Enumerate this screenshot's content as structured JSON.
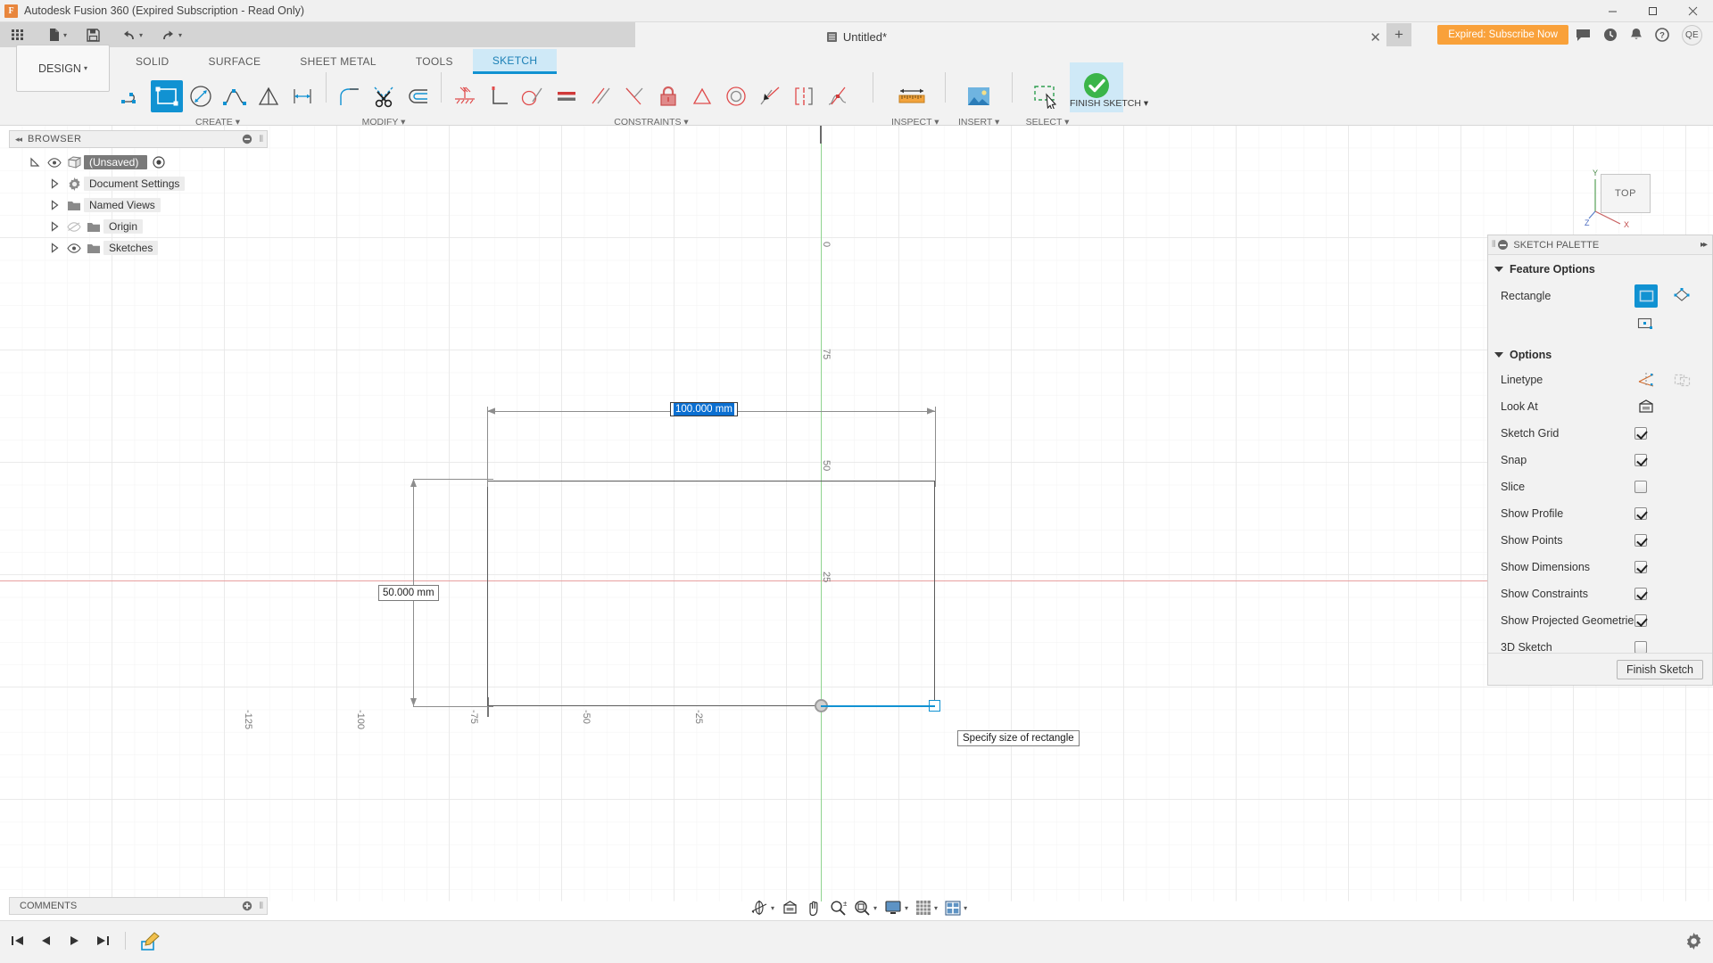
{
  "window": {
    "title": "Autodesk Fusion 360 (Expired Subscription - Read Only)",
    "logo_letter": "F",
    "minimize": "–",
    "maximize": "□",
    "close": "✕"
  },
  "quick_access": {
    "grid_icon": "app-grid-icon",
    "new_label": "new-file-icon",
    "save_label": "save-icon",
    "undo_label": "undo-icon",
    "redo_label": "redo-icon",
    "caret": "▾"
  },
  "header": {
    "document_name": "Untitled*",
    "tab_close": "✕",
    "tab_new": "+",
    "subscribe_label": "Expired: Subscribe Now",
    "avatar_initials": "QE",
    "icons": [
      "comments-icon",
      "recent-icon",
      "notifications-icon",
      "help-icon"
    ]
  },
  "ribbon": {
    "workspace_label": "DESIGN",
    "workspace_caret": "▾",
    "tabs": [
      {
        "label": "SOLID",
        "active": false
      },
      {
        "label": "SURFACE",
        "active": false
      },
      {
        "label": "SHEET METAL",
        "active": false
      },
      {
        "label": "TOOLS",
        "active": false
      },
      {
        "label": "SKETCH",
        "active": true
      }
    ],
    "groups": [
      {
        "label": "CREATE ▾",
        "name": "create-group"
      },
      {
        "label": "MODIFY ▾",
        "name": "modify-group"
      },
      {
        "label": "CONSTRAINTS ▾",
        "name": "constraints-group"
      },
      {
        "label": "INSPECT ▾",
        "name": "inspect-group"
      },
      {
        "label": "INSERT ▾",
        "name": "insert-group"
      },
      {
        "label": "SELECT ▾",
        "name": "select-group"
      },
      {
        "label": "FINISH SKETCH ▾",
        "name": "finish-sketch-group"
      }
    ],
    "tools": {
      "line": "line-icon",
      "rectangle": "rectangle-icon",
      "circle": "circle-icon",
      "spline": "spline-icon",
      "polygon": "polygon-icon",
      "sketch_dimension": "sketch-dimension-icon",
      "fillet": "fillet-icon",
      "trim": "trim-scissors-icon",
      "offset": "offset-icon",
      "constraint_fix": "fix-constraint-icon",
      "perpendicular": "perpendicular-icon",
      "tangent": "tangent-icon",
      "equal": "equal-icon",
      "parallel": "parallel-icon",
      "midpoint": "midpoint-icon",
      "lock": "lock-icon",
      "symmetry": "symmetry-icon",
      "concentric": "concentric-icon",
      "collinear": "collinear-icon",
      "curvature": "curvature-icon",
      "smooth": "smooth-icon",
      "measure": "measure-ruler-icon",
      "insert_image": "insert-image-icon",
      "select_window": "select-window-icon",
      "finish_sketch": "finish-sketch-check-icon"
    }
  },
  "browser": {
    "panel_title": "BROWSER",
    "collapse_icon": "◂◂",
    "minimize_icon": "⊖",
    "items": [
      {
        "label": "(Unsaved)",
        "icon": "component-cube-icon",
        "selected": true,
        "visible": true,
        "indent": 0,
        "has_radio": true
      },
      {
        "label": "Document Settings",
        "icon": "gear-icon",
        "selected": false,
        "visible": null,
        "indent": 1,
        "has_radio": false
      },
      {
        "label": "Named Views",
        "icon": "folder-icon",
        "selected": false,
        "visible": null,
        "indent": 1,
        "has_radio": false
      },
      {
        "label": "Origin",
        "icon": "folder-icon",
        "selected": false,
        "visible": false,
        "indent": 1,
        "has_radio": false
      },
      {
        "label": "Sketches",
        "icon": "folder-icon",
        "selected": false,
        "visible": true,
        "indent": 1,
        "has_radio": false
      }
    ]
  },
  "canvas": {
    "tick_labels_x": [
      "-125",
      "-100",
      "-75",
      "-50",
      "-25"
    ],
    "tick_labels_y": [
      "0",
      "75",
      "50",
      "25"
    ],
    "dimension_width": {
      "value": "100.000 mm",
      "editing": true
    },
    "dimension_height": {
      "value": "50.000 mm",
      "editing": false
    },
    "tooltip": "Specify size of rectangle",
    "origin_point": "sketch-origin-point",
    "horizontal_axis_color": "#e8a0a0",
    "vertical_axis_color": "#8fd48f",
    "selection_color": "#1192d2"
  },
  "viewcube": {
    "face_label": "TOP",
    "axis_x": "X",
    "axis_y": "Y",
    "axis_z": "Z"
  },
  "sketch_palette": {
    "title": "SKETCH PALETTE",
    "expand_icon": "▸▸",
    "sections": [
      {
        "title": "Feature Options",
        "rows": [
          {
            "label": "Rectangle",
            "type": "icon-group",
            "name": "rectangle-mode",
            "icons": [
              "2-point-rectangle-icon",
              "3-point-rectangle-icon",
              "center-rectangle-icon"
            ],
            "selected_index": 0
          }
        ]
      },
      {
        "title": "Options",
        "rows": [
          {
            "label": "Linetype",
            "type": "icon-group",
            "name": "linetype",
            "icons": [
              "construction-line-icon",
              "centerline-icon"
            ],
            "selected_index": -1
          },
          {
            "label": "Look At",
            "type": "icon",
            "name": "look-at",
            "icons": [
              "look-at-icon"
            ]
          },
          {
            "label": "Sketch Grid",
            "type": "checkbox",
            "checked": true
          },
          {
            "label": "Snap",
            "type": "checkbox",
            "checked": true
          },
          {
            "label": "Slice",
            "type": "checkbox",
            "checked": false
          },
          {
            "label": "Show Profile",
            "type": "checkbox",
            "checked": true
          },
          {
            "label": "Show Points",
            "type": "checkbox",
            "checked": true
          },
          {
            "label": "Show Dimensions",
            "type": "checkbox",
            "checked": true
          },
          {
            "label": "Show Constraints",
            "type": "checkbox",
            "checked": true
          },
          {
            "label": "Show Projected Geometries",
            "type": "checkbox",
            "checked": true
          },
          {
            "label": "3D Sketch",
            "type": "checkbox",
            "checked": false
          }
        ]
      }
    ],
    "finish_button": "Finish Sketch"
  },
  "comments": {
    "title": "COMMENTS",
    "add_icon": "⊕"
  },
  "navigation_bar": {
    "buttons": [
      "orbit-icon",
      "look-at-icon",
      "pan-hand-icon",
      "zoom-icon",
      "fit-icon",
      "display-settings-icon",
      "grid-snaps-icon",
      "viewports-icon"
    ],
    "caret": "▾"
  },
  "timeline": {
    "buttons": [
      "go-to-start-icon",
      "step-back-icon",
      "play-icon",
      "go-to-end-icon",
      "sketch-timeline-icon"
    ],
    "settings": "settings-gear-icon"
  }
}
